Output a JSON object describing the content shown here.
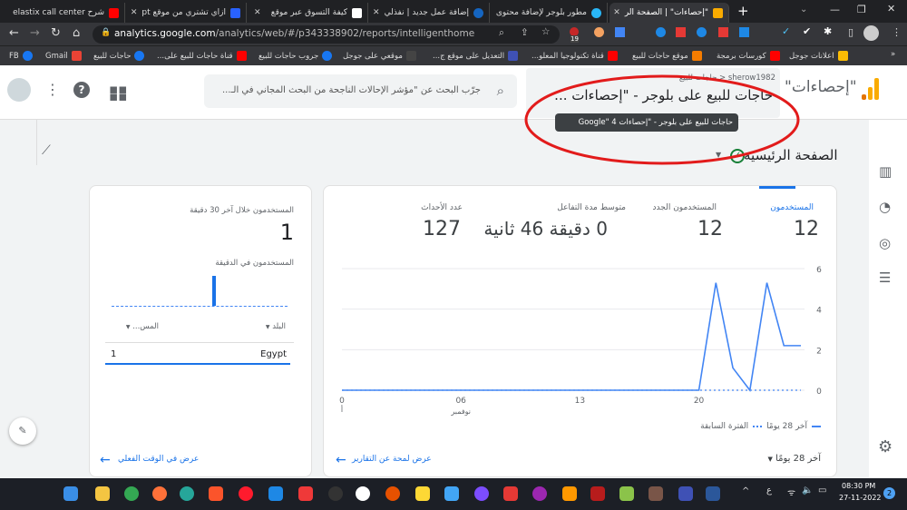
{
  "browser": {
    "tabs": [
      {
        "label": "شرح elastix call center",
        "color": "#ff0000"
      },
      {
        "label": "ازاي تشتري من موقع pt",
        "color": "#2962ff"
      },
      {
        "label": "كيفة التسوق عبر موقع",
        "color": "#ffffff"
      },
      {
        "label": "إضافة عمل جديد | نفذلي",
        "color": "#1565c0"
      },
      {
        "label": "مطور بلوجر لإضافة محتوى",
        "color": "#29b6f6"
      },
      {
        "label": "\"إحصاءات\" | الصفحة الر",
        "color": "#f9ab00"
      }
    ],
    "new_tab": "+",
    "url_host": "analytics.google.com",
    "url_path": "/analytics/web/#/p343338902/reports/intelligenthome",
    "extension_badge": "19",
    "bookmarks": [
      "FB",
      "Gmail",
      "حاجات للبيع",
      "قناة حاجات للبيع على...",
      "جروب حاجات للبيع",
      "موقعي على جوجل",
      "التعديل على موقع ج...",
      "قناة تكنولوجيا المعلو...",
      "موقع حاجات للبيع",
      "كورسات برمجة",
      "اعلانات جوجل"
    ],
    "more_bookmarks": "»"
  },
  "header": {
    "product": "\"إحصاءات\"",
    "account_line": "sherow1982 < حاجات للبيع",
    "property": "حاجات للبيع على بلوجر - \"إحصاءات ...",
    "tooltip": "حاجات للبيع على بلوجر - \"إحصاءات Google\" 4",
    "search_placeholder": "جرّب البحث عن \"مؤشر الإحالات الناجحة من البحث المجاني في الـ..."
  },
  "page": {
    "title": "الصفحة الرئيسية"
  },
  "metrics": [
    {
      "label": "المستخدمون",
      "value": "12",
      "active": true
    },
    {
      "label": "المستخدمون الجدد",
      "value": "12"
    },
    {
      "label": "متوسط مدة التفاعل",
      "value": "0 دقيقة 46 ثانية"
    },
    {
      "label": "عدد الأحداث",
      "value": "127"
    }
  ],
  "chart_data": {
    "type": "line",
    "x_ticks": [
      "0",
      "06",
      "13",
      "20"
    ],
    "x_sublabel": "نوفمبر",
    "x_first_sublabel": "أ",
    "y_ticks": [
      "0",
      "2",
      "4",
      "6"
    ],
    "ylim": [
      0,
      6
    ],
    "series": [
      {
        "name": "آخر 28 يومًا",
        "style": "solid",
        "color": "#4285f4",
        "values": [
          0,
          0,
          0,
          0,
          0,
          0,
          0,
          0,
          0,
          0,
          0,
          0,
          0,
          0,
          0,
          0,
          0,
          0,
          0,
          0,
          0,
          0,
          5.3,
          1.1,
          0,
          5.3,
          2.2,
          2.2
        ]
      },
      {
        "name": "الفترة السابقة",
        "style": "dashed",
        "color": "#4285f4",
        "values": [
          0,
          0,
          0,
          0,
          0,
          0,
          0,
          0,
          0,
          0,
          0,
          0,
          0,
          0,
          0,
          0,
          0,
          0,
          0,
          0,
          0,
          0,
          0,
          0,
          0,
          0,
          0,
          0
        ]
      }
    ]
  },
  "main_card": {
    "date_range": "آخر 28 يومًا",
    "reports_link": "عرض لمحة عن التقارير"
  },
  "realtime": {
    "title": "المستخدمون خلال آخر 30 دقيقة",
    "value": "1",
    "per_minute": "المستخدمون في الدقيقة",
    "col_country": "البلد",
    "col_users": "المس...",
    "rows": [
      {
        "country": "Egypt",
        "users": "1"
      }
    ],
    "link": "عرض في الوقت الفعلي"
  },
  "taskbar": {
    "time": "08:30 PM",
    "date": "27-11-2022",
    "lang": "ع",
    "notif": "2"
  }
}
